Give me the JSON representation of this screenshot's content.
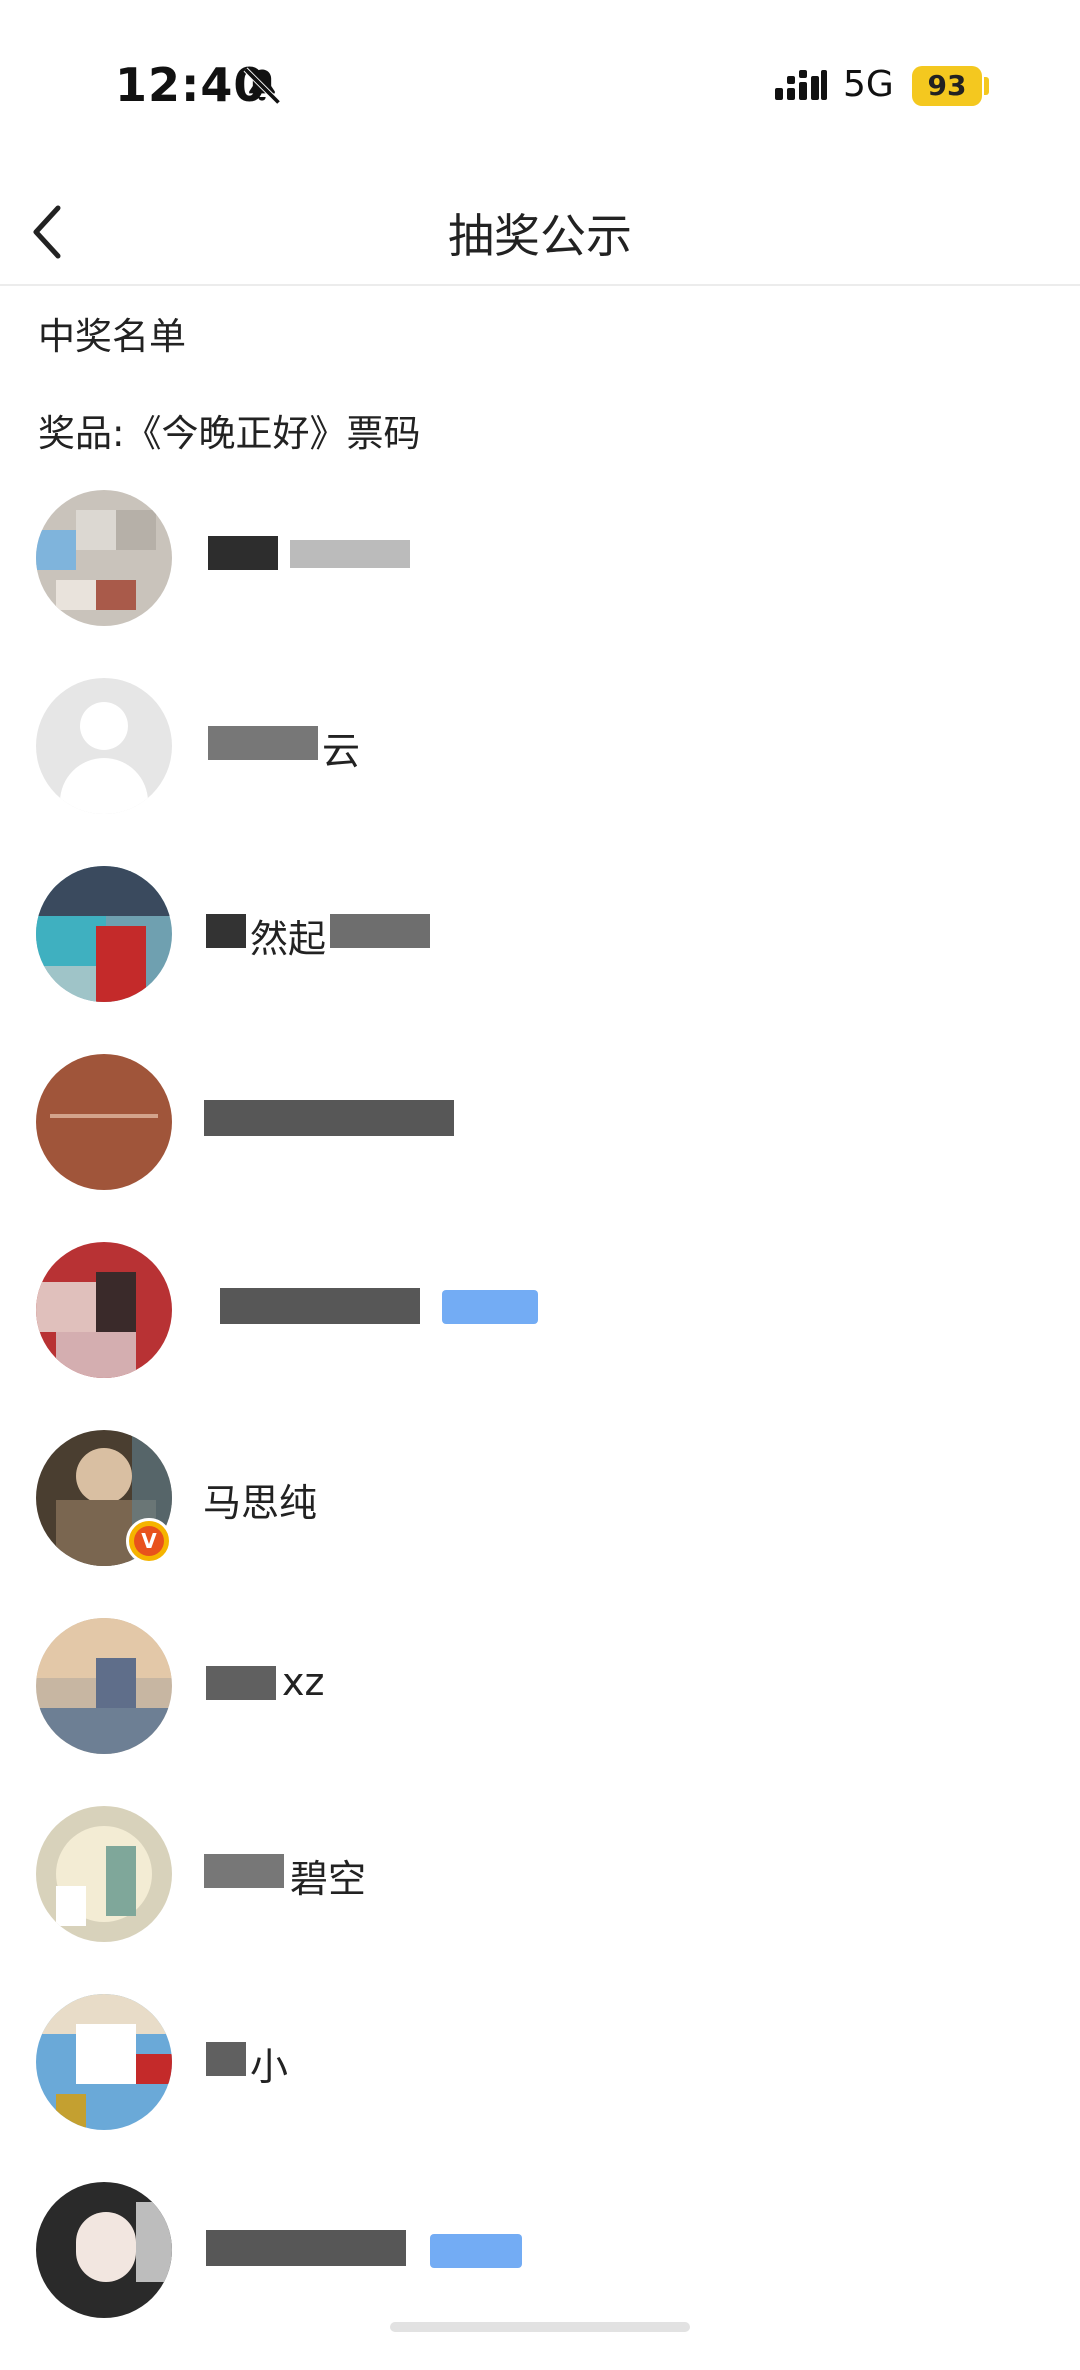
{
  "status_bar": {
    "time": "12:40",
    "network": "5G",
    "battery": "93",
    "icons": [
      "bell-off-icon",
      "signal-icon"
    ]
  },
  "nav": {
    "title": "抽奖公示",
    "back_icon": "chevron-left-icon"
  },
  "section": {
    "heading": "中奖名单",
    "prize": "奖品:《今晚正好》票码"
  },
  "winners": [
    {
      "name": "",
      "avatar_color": "#c9c3bb"
    },
    {
      "name": "云",
      "avatar_color": "#e6e6e6"
    },
    {
      "name": "然起",
      "avatar_color": "#6fa0b0"
    },
    {
      "name": "",
      "avatar_color": "#a0553a"
    },
    {
      "name": "",
      "avatar_color": "#b83234"
    },
    {
      "name": "马思纯",
      "avatar_color": "#4a3e30",
      "verified": true
    },
    {
      "name": "xz",
      "avatar_color": "#c7b6a2"
    },
    {
      "name": "碧空",
      "avatar_color": "#d8d2bb"
    },
    {
      "name": "小",
      "avatar_color": "#6aa9d8"
    },
    {
      "name": "",
      "avatar_color": "#2a2a2a"
    }
  ],
  "colors": {
    "accent_yellow": "#f4c81f",
    "verified_orange": "#e8521c",
    "tag_blue": "#5b9ef2"
  }
}
